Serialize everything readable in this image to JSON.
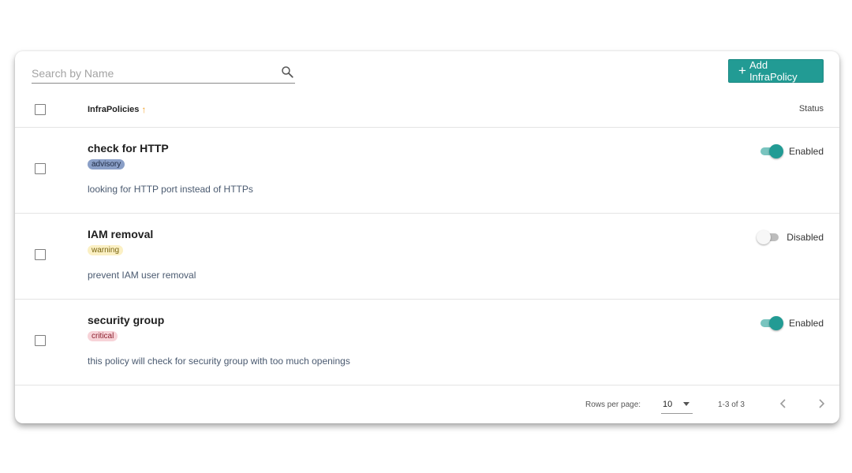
{
  "toolbar": {
    "search_placeholder": "Search by Name",
    "add_button_label": "Add InfraPolicy",
    "add_button_icon": "plus-icon",
    "accent_color": "#229b94"
  },
  "table": {
    "columns": {
      "name": "InfraPolicies",
      "status": "Status"
    },
    "rows": [
      {
        "name": "check for HTTP",
        "severity": "advisory",
        "description": "looking for HTTP port instead of HTTPs",
        "enabled": true,
        "status_label": "Enabled"
      },
      {
        "name": "IAM removal",
        "severity": "warning",
        "description": "prevent IAM user removal",
        "enabled": false,
        "status_label": "Disabled"
      },
      {
        "name": "security group",
        "severity": "critical",
        "description": "this policy will check for security group with too much openings",
        "enabled": true,
        "status_label": "Enabled"
      }
    ]
  },
  "pagination": {
    "rows_per_page_label": "Rows per page:",
    "rows_per_page_value": "10",
    "range_text": "1-3 of 3"
  }
}
